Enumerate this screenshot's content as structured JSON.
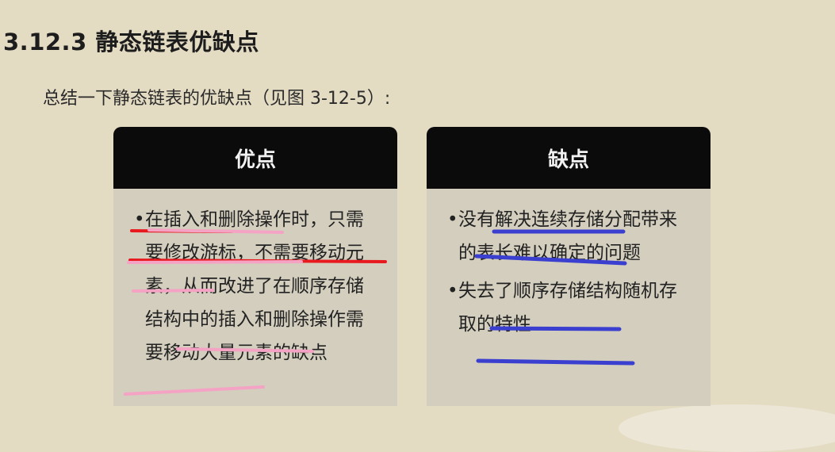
{
  "section": {
    "title": "3.12.3  静态链表优缺点",
    "intro": "总结一下静态链表的优缺点（见图 3-12-5）:"
  },
  "pros": {
    "header": "优点",
    "items": [
      "在插入和删除操作时，只需要修改游标，不需要移动元素，从而改进了在顺序存储结构中的插入和删除操作需要移动大量元素的缺点"
    ]
  },
  "cons": {
    "header": "缺点",
    "items": [
      "没有解决连续存储分配带来的表长难以确定的问题",
      "失去了顺序存储结构随机存取的特性"
    ]
  },
  "bullet": "•",
  "annotation_colors": {
    "red": "#e8191f",
    "pink": "#f5a3c4",
    "blue": "#3a3fcf"
  }
}
